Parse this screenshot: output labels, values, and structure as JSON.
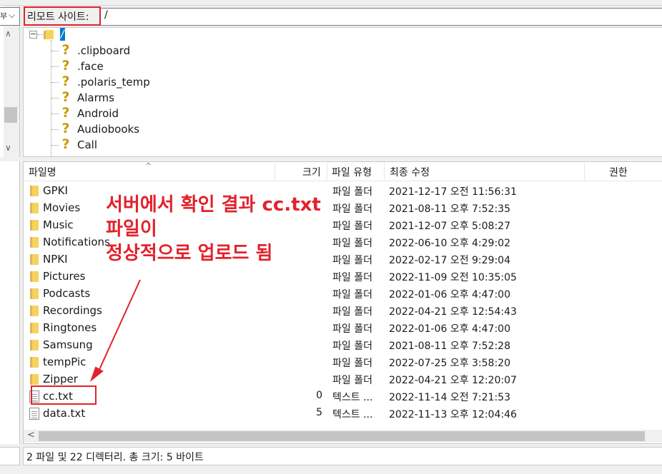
{
  "left_pane": {
    "combo_fragment": "부"
  },
  "remote_site": {
    "label": "리모트 사이트:",
    "path": "/"
  },
  "tree": {
    "root": "/",
    "items": [
      ".clipboard",
      ".face",
      ".polaris_temp",
      "Alarms",
      "Android",
      "Audiobooks",
      "Call"
    ]
  },
  "file_list": {
    "columns": {
      "name": "파일명",
      "size": "크기",
      "type": "파일 유형",
      "modified": "최종 수정",
      "perms": "권한"
    },
    "rows": [
      {
        "name": "GPKI",
        "kind": "folder",
        "size": "",
        "type": "파일 폴더",
        "modified": "2021-12-17 오전 11:56:31"
      },
      {
        "name": "Movies",
        "kind": "folder",
        "size": "",
        "type": "파일 폴더",
        "modified": "2021-08-11 오후 7:52:35"
      },
      {
        "name": "Music",
        "kind": "folder",
        "size": "",
        "type": "파일 폴더",
        "modified": "2021-12-07 오후 5:08:27"
      },
      {
        "name": "Notifications",
        "kind": "folder",
        "size": "",
        "type": "파일 폴더",
        "modified": "2022-06-10 오후 4:29:02"
      },
      {
        "name": "NPKI",
        "kind": "folder",
        "size": "",
        "type": "파일 폴더",
        "modified": "2022-02-17 오전 9:29:04"
      },
      {
        "name": "Pictures",
        "kind": "folder",
        "size": "",
        "type": "파일 폴더",
        "modified": "2022-11-09 오전 10:35:05"
      },
      {
        "name": "Podcasts",
        "kind": "folder",
        "size": "",
        "type": "파일 폴더",
        "modified": "2022-01-06 오후 4:47:00"
      },
      {
        "name": "Recordings",
        "kind": "folder",
        "size": "",
        "type": "파일 폴더",
        "modified": "2022-04-21 오후 12:54:43"
      },
      {
        "name": "Ringtones",
        "kind": "folder",
        "size": "",
        "type": "파일 폴더",
        "modified": "2022-01-06 오후 4:47:00"
      },
      {
        "name": "Samsung",
        "kind": "folder",
        "size": "",
        "type": "파일 폴더",
        "modified": "2021-08-11 오후 7:52:28"
      },
      {
        "name": "tempPic",
        "kind": "folder",
        "size": "",
        "type": "파일 폴더",
        "modified": "2022-07-25 오후 3:58:20"
      },
      {
        "name": "Zipper",
        "kind": "folder",
        "size": "",
        "type": "파일 폴더",
        "modified": "2022-04-21 오후 12:20:07"
      },
      {
        "name": "cc.txt",
        "kind": "file",
        "size": "0",
        "type": "텍스트 ...",
        "modified": "2022-11-14 오전 7:21:53"
      },
      {
        "name": "data.txt",
        "kind": "file",
        "size": "5",
        "type": "텍스트 ...",
        "modified": "2022-11-13 오후 12:04:46"
      }
    ]
  },
  "status": "2 파일 및 22 디렉터리. 총 크기: 5 바이트",
  "annotation": {
    "lines": [
      "서버에서 확인 결과 cc.txt",
      "파일이",
      "정상적으로 업로드 됨"
    ],
    "color": "#e2222c"
  }
}
